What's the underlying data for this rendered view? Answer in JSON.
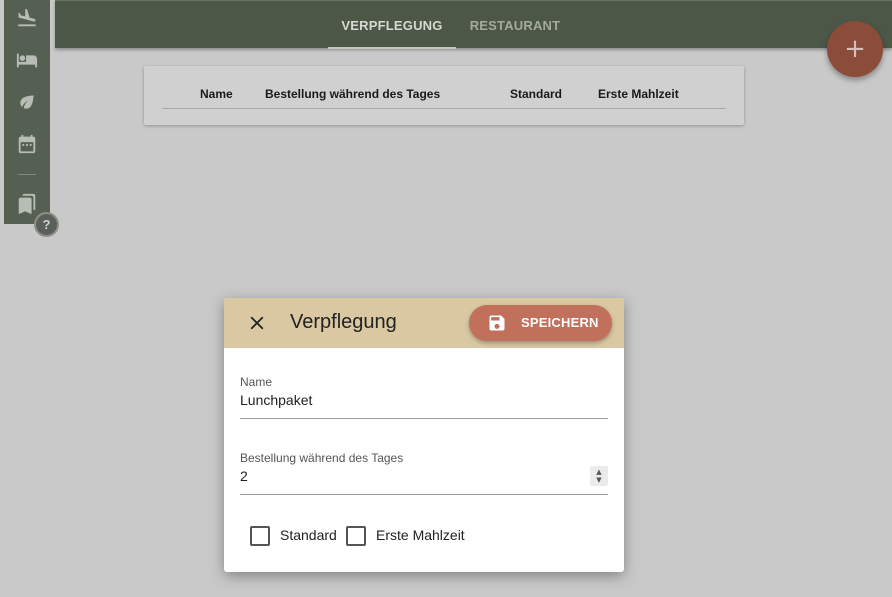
{
  "nav": {
    "items": [
      {
        "icon": "flight-land-icon"
      },
      {
        "icon": "hotel-bed-icon"
      },
      {
        "icon": "leaf-icon"
      },
      {
        "icon": "calendar-icon"
      },
      {
        "icon": "bookmarks-icon"
      }
    ],
    "help_label": "?"
  },
  "tabs": [
    {
      "label": "VERPFLEGUNG",
      "active": true
    },
    {
      "label": "RESTAURANT",
      "active": false
    }
  ],
  "fab": {
    "label": "+"
  },
  "table": {
    "headers": [
      "Name",
      "Bestellung während des Tages",
      "Standard",
      "Erste Mahlzeit"
    ]
  },
  "dialog": {
    "title": "Verpflegung",
    "save_label": "SPEICHERN",
    "fields": {
      "name": {
        "label": "Name",
        "value": "Lunchpaket"
      },
      "order": {
        "label": "Bestellung während des Tages",
        "value": "2"
      }
    },
    "checkboxes": {
      "standard": {
        "label": "Standard",
        "checked": false
      },
      "first_meal": {
        "label": "Erste Mahlzeit",
        "checked": false
      }
    }
  },
  "colors": {
    "topbar": "#4d5748",
    "dialog_header": "#d9c8a2",
    "save_button": "#c1705b",
    "fab": "#8b4c3a"
  }
}
